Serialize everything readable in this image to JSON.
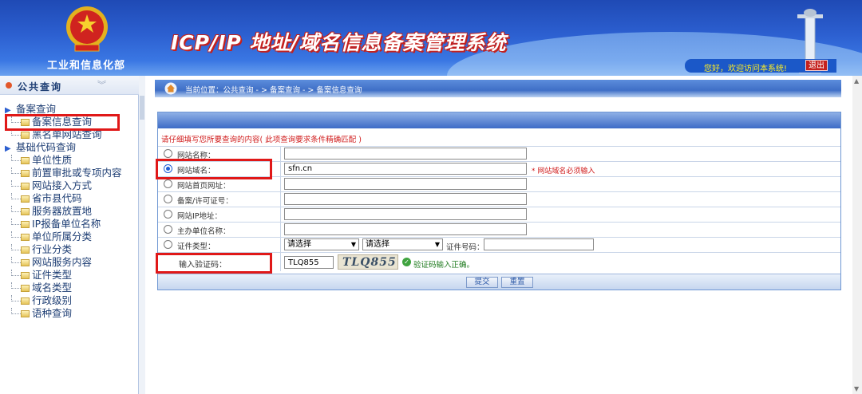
{
  "header": {
    "org_name": "工业和信息化部",
    "system_title": "ICP/IP 地址/域名信息备案管理系统",
    "welcome": "您好，欢迎访问本系统!",
    "logout_label": "退出"
  },
  "sidebar": {
    "title": "公共查询",
    "tree": [
      {
        "label": "备案查询",
        "type": "group"
      },
      {
        "label": "备案信息查询",
        "type": "leaf"
      },
      {
        "label": "黑名单网站查询",
        "type": "leaf"
      },
      {
        "label": "基础代码查询",
        "type": "group"
      },
      {
        "label": "单位性质",
        "type": "leaf"
      },
      {
        "label": "前置审批或专项内容",
        "type": "leaf"
      },
      {
        "label": "网站接入方式",
        "type": "leaf"
      },
      {
        "label": "省市县代码",
        "type": "leaf"
      },
      {
        "label": "服务器放置地",
        "type": "leaf"
      },
      {
        "label": "IP报备单位名称",
        "type": "leaf"
      },
      {
        "label": "单位所属分类",
        "type": "leaf"
      },
      {
        "label": "行业分类",
        "type": "leaf"
      },
      {
        "label": "网站服务内容",
        "type": "leaf"
      },
      {
        "label": "证件类型",
        "type": "leaf"
      },
      {
        "label": "域名类型",
        "type": "leaf"
      },
      {
        "label": "行政级别",
        "type": "leaf"
      },
      {
        "label": "语种查询",
        "type": "leaf"
      }
    ]
  },
  "breadcrumb": "当前位置：公共查询 - > 备案查询 - > 备案信息查询",
  "form": {
    "hint": "请仔细填写您所要查询的内容( 此项查询要求条件精确匹配 )",
    "fields": [
      {
        "label": "网站名称：",
        "value": "",
        "selected": false
      },
      {
        "label": "网站域名：",
        "value": "sfn.cn",
        "selected": true,
        "required_note": "* 网站域名必须输入"
      },
      {
        "label": "网站首页网址：",
        "value": "",
        "selected": false
      },
      {
        "label": "备案/许可证号：",
        "value": "",
        "selected": false
      },
      {
        "label": "网站IP地址：",
        "value": "",
        "selected": false
      },
      {
        "label": "主办单位名称：",
        "value": "",
        "selected": false
      }
    ],
    "cert": {
      "label": "证件类型：",
      "select1": "请选择",
      "select2": "请选择",
      "cert_no_label": "证件号码："
    },
    "captcha": {
      "label": "输入验证码：",
      "value": "TLQ855",
      "image_text": "TLQ855",
      "ok_text": "验证码输入正确。"
    },
    "submit_label": "提交",
    "reset_label": "重置"
  }
}
